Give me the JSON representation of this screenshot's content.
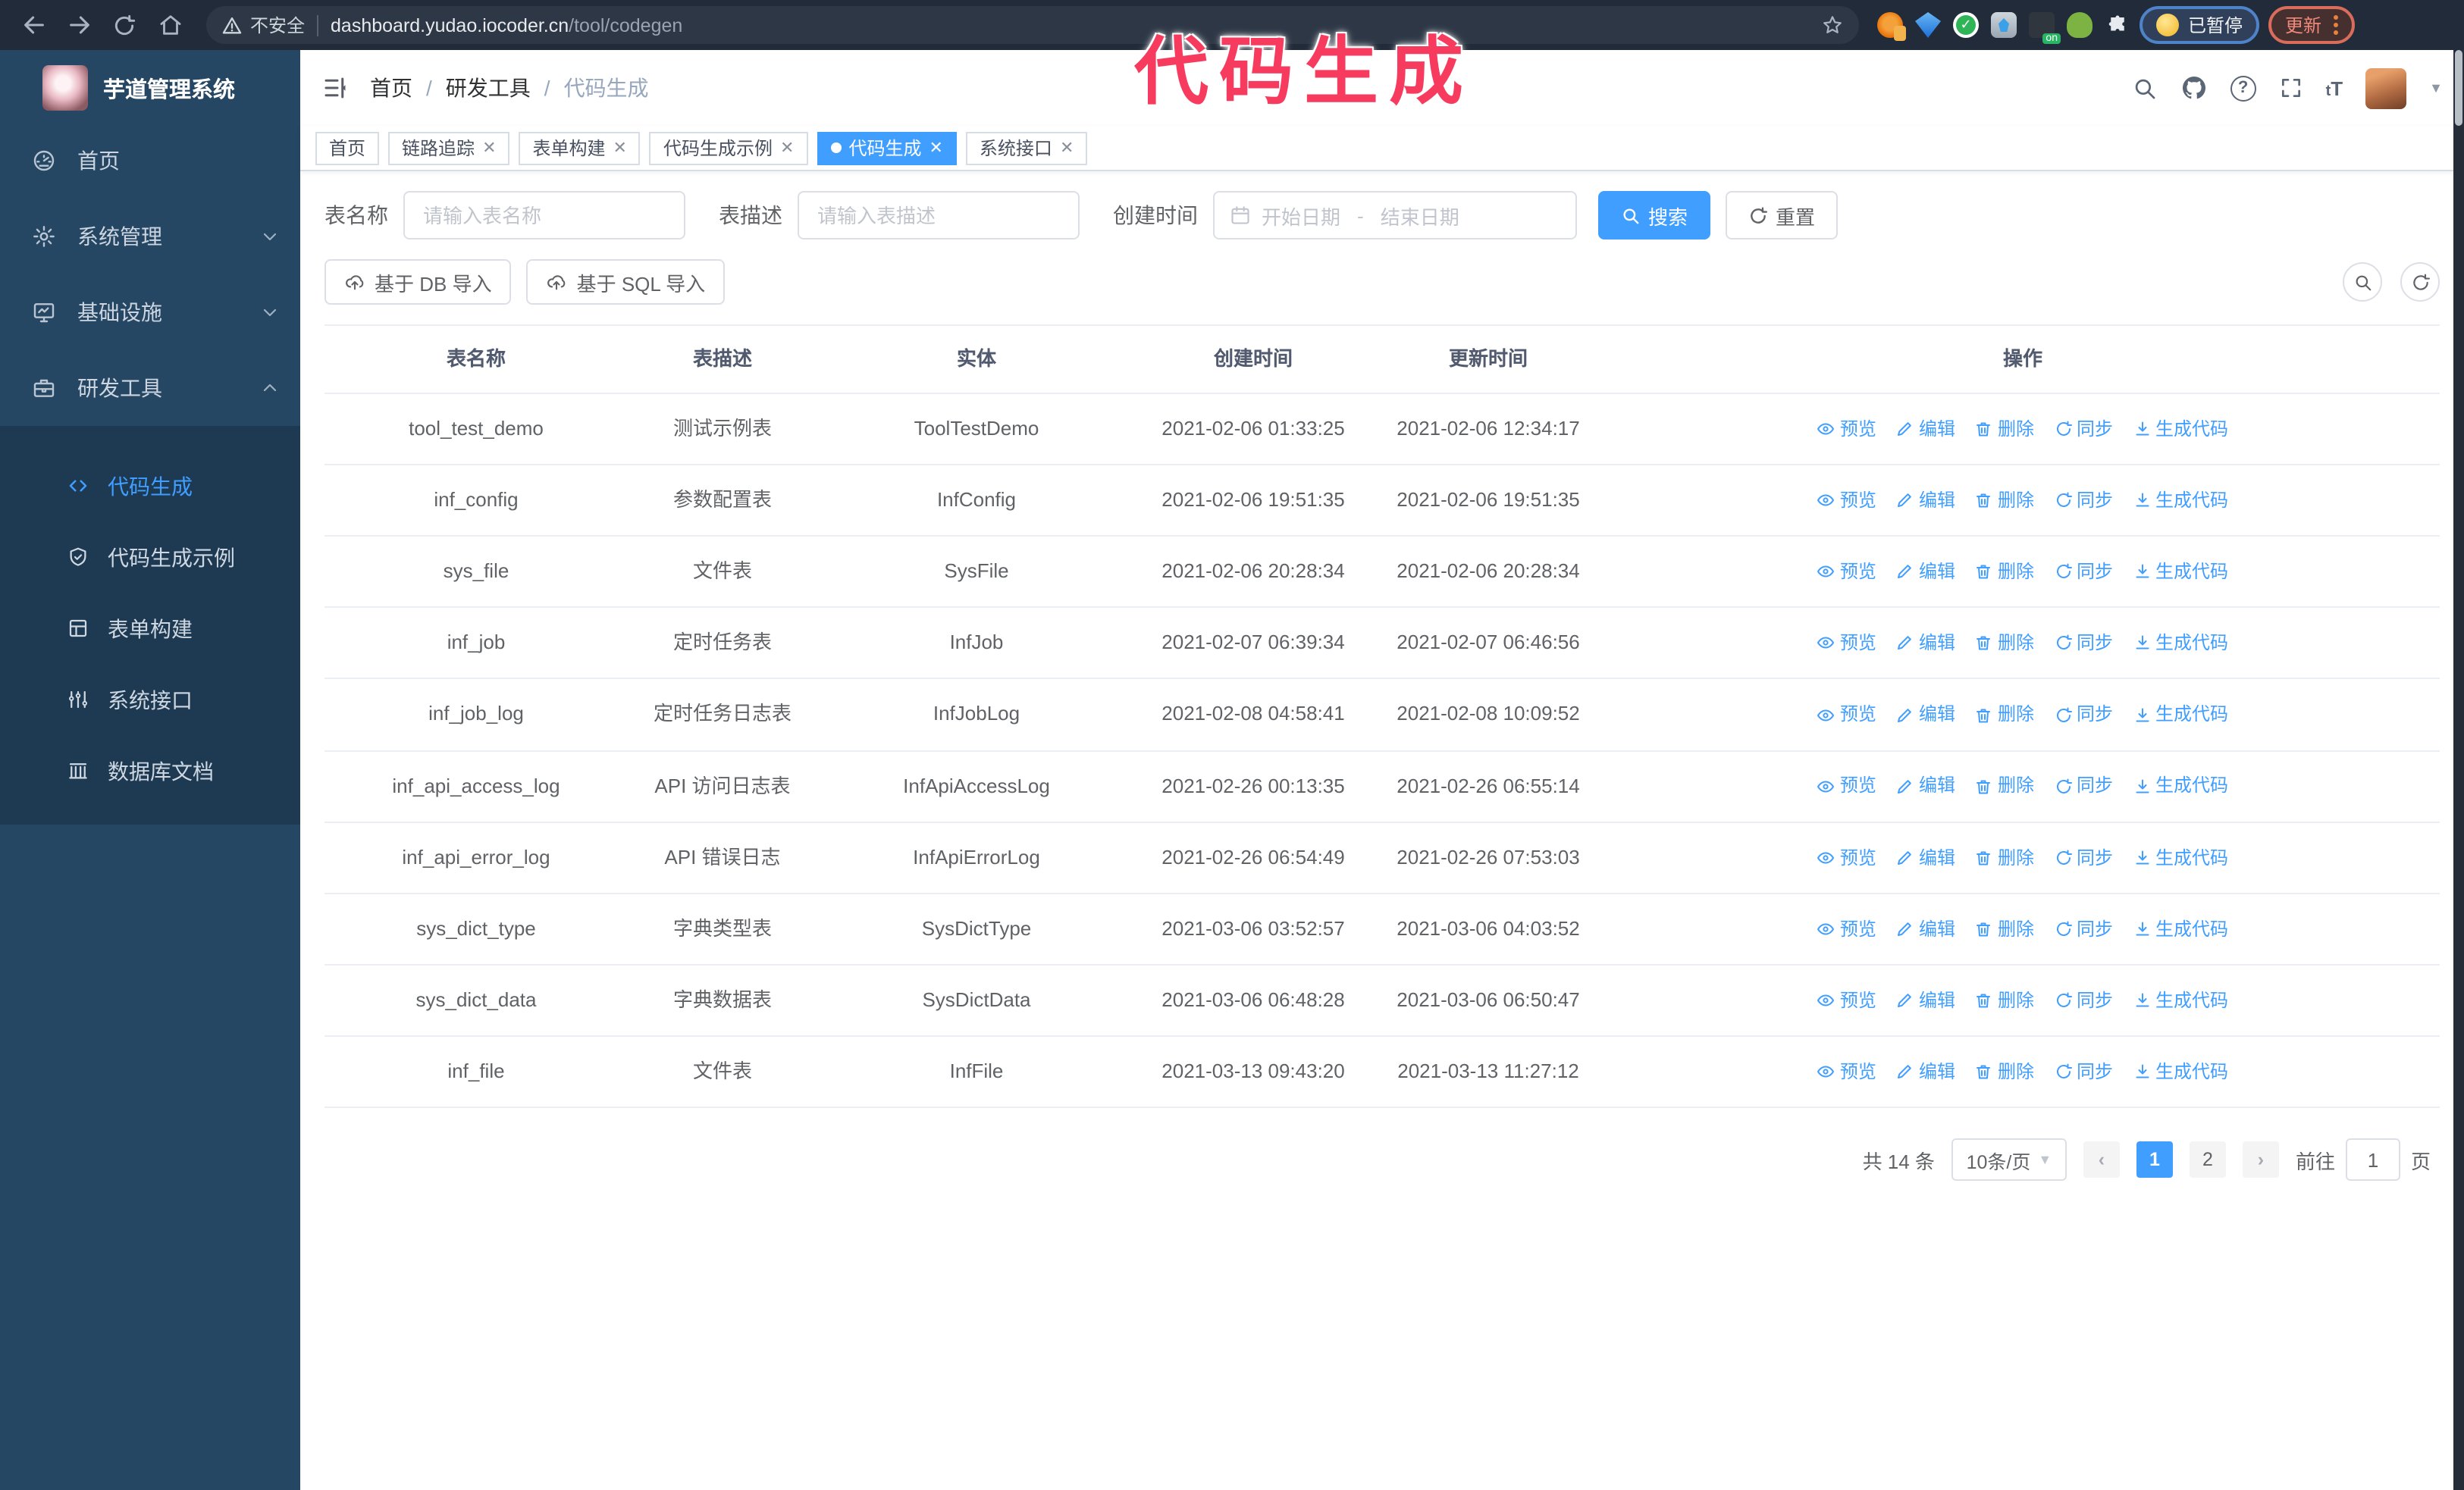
{
  "browser": {
    "security_label": "不安全",
    "url_host": "dashboard.yudao.iocoder.cn",
    "url_path": "/tool/codegen",
    "paused_badge": "已暂停",
    "update_button": "更新"
  },
  "annotation": {
    "text": "代码生成",
    "color": "#f73b5f"
  },
  "sidebar": {
    "app_title": "芋道管理系统",
    "items": [
      {
        "label": "首页"
      },
      {
        "label": "系统管理"
      },
      {
        "label": "基础设施"
      },
      {
        "label": "研发工具"
      }
    ],
    "sub_items": [
      {
        "label": "代码生成"
      },
      {
        "label": "代码生成示例"
      },
      {
        "label": "表单构建"
      },
      {
        "label": "系统接口"
      },
      {
        "label": "数据库文档"
      }
    ]
  },
  "header": {
    "breadcrumb": [
      "首页",
      "研发工具",
      "代码生成"
    ]
  },
  "tabs": [
    {
      "label": "首页"
    },
    {
      "label": "链路追踪"
    },
    {
      "label": "表单构建"
    },
    {
      "label": "代码生成示例"
    },
    {
      "label": "代码生成"
    },
    {
      "label": "系统接口"
    }
  ],
  "filters": {
    "table_name_label": "表名称",
    "table_name_placeholder": "请输入表名称",
    "table_desc_label": "表描述",
    "table_desc_placeholder": "请输入表描述",
    "create_time_label": "创建时间",
    "date_start_placeholder": "开始日期",
    "date_separator": "-",
    "date_end_placeholder": "结束日期",
    "search_button": "搜索",
    "reset_button": "重置"
  },
  "toolbar": {
    "import_db_button": "基于 DB 导入",
    "import_sql_button": "基于 SQL 导入"
  },
  "table": {
    "columns": [
      "表名称",
      "表描述",
      "实体",
      "创建时间",
      "更新时间",
      "操作"
    ],
    "rows": [
      {
        "name": "tool_test_demo",
        "desc": "测试示例表",
        "entity": "ToolTestDemo",
        "create_time": "2021-02-06 01:33:25",
        "update_time": "2021-02-06 12:34:17"
      },
      {
        "name": "inf_config",
        "desc": "参数配置表",
        "entity": "InfConfig",
        "create_time": "2021-02-06 19:51:35",
        "update_time": "2021-02-06 19:51:35"
      },
      {
        "name": "sys_file",
        "desc": "文件表",
        "entity": "SysFile",
        "create_time": "2021-02-06 20:28:34",
        "update_time": "2021-02-06 20:28:34"
      },
      {
        "name": "inf_job",
        "desc": "定时任务表",
        "entity": "InfJob",
        "create_time": "2021-02-07 06:39:34",
        "update_time": "2021-02-07 06:46:56"
      },
      {
        "name": "inf_job_log",
        "desc": "定时任务日志表",
        "entity": "InfJobLog",
        "create_time": "2021-02-08 04:58:41",
        "update_time": "2021-02-08 10:09:52"
      },
      {
        "name": "inf_api_access_log",
        "desc": "API 访问日志表",
        "entity": "InfApiAccessLog",
        "create_time": "2021-02-26 00:13:35",
        "update_time": "2021-02-26 06:55:14"
      },
      {
        "name": "inf_api_error_log",
        "desc": "API 错误日志",
        "entity": "InfApiErrorLog",
        "create_time": "2021-02-26 06:54:49",
        "update_time": "2021-02-26 07:53:03"
      },
      {
        "name": "sys_dict_type",
        "desc": "字典类型表",
        "entity": "SysDictType",
        "create_time": "2021-03-06 03:52:57",
        "update_time": "2021-03-06 04:03:52"
      },
      {
        "name": "sys_dict_data",
        "desc": "字典数据表",
        "entity": "SysDictData",
        "create_time": "2021-03-06 06:48:28",
        "update_time": "2021-03-06 06:50:47"
      },
      {
        "name": "inf_file",
        "desc": "文件表",
        "entity": "InfFile",
        "create_time": "2021-03-13 09:43:20",
        "update_time": "2021-03-13 11:27:12"
      }
    ],
    "actions": [
      {
        "label": "预览"
      },
      {
        "label": "编辑"
      },
      {
        "label": "删除"
      },
      {
        "label": "同步"
      },
      {
        "label": "生成代码"
      }
    ]
  },
  "pagination": {
    "total": "共 14 条",
    "page_size": "10条/页",
    "pages": [
      "1",
      "2"
    ],
    "goto_label": "前往",
    "goto_value": "1",
    "goto_suffix": "页"
  }
}
